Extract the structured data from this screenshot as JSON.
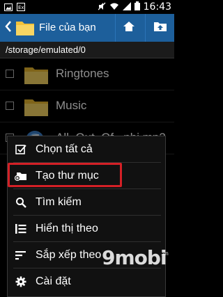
{
  "status_bar": {
    "time": "16:43",
    "battery": "",
    "signal": ""
  },
  "app_bar": {
    "title": "File của bạn"
  },
  "path": "/storage/emulated/0",
  "files": [
    {
      "name": "Ringtones",
      "type": "folder"
    },
    {
      "name": "Music",
      "type": "folder"
    },
    {
      "name": "All_Out_Of...nhi.mp3",
      "type": "audio"
    }
  ],
  "menu": {
    "items": [
      {
        "label": "Chọn tất cả",
        "icon": "checkbox-icon"
      },
      {
        "label": "Tạo thư mục",
        "icon": "new-folder-icon"
      },
      {
        "label": "Tìm kiếm",
        "icon": "search-icon"
      },
      {
        "label": "Hiển thị theo",
        "icon": "view-list-icon"
      },
      {
        "label": "Sắp xếp theo",
        "icon": "sort-icon"
      },
      {
        "label": "Cài đặt",
        "icon": "gear-icon"
      }
    ]
  },
  "watermark": {
    "text": "9mobi",
    "suffix": ".vn"
  },
  "colors": {
    "app_bar": "#1d5f9b",
    "folder": "#f2c23a",
    "highlight": "#d42026",
    "watermark": "#ffffff"
  }
}
